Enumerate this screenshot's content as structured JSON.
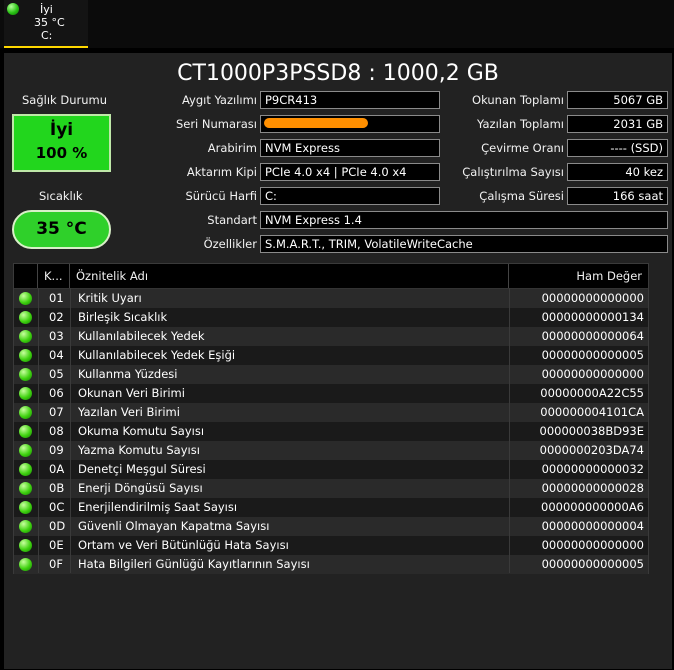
{
  "disk_tab": {
    "status": "İyi",
    "temperature": "35 °C",
    "drive_letter": "C:"
  },
  "title": "CT1000P3PSSD8 : 1000,2 GB",
  "health": {
    "label": "Sağlık Durumu",
    "status": "İyi",
    "percent": "100 %"
  },
  "temperature": {
    "label": "Sıcaklık",
    "value": "35 °C"
  },
  "info": {
    "firmware": {
      "label": "Aygıt Yazılımı",
      "value": "P9CR413"
    },
    "serial": {
      "label": "Seri Numarası",
      "value": ""
    },
    "interface": {
      "label": "Arabirim",
      "value": "NVM Express"
    },
    "transfer_mode": {
      "label": "Aktarım Kipi",
      "value": "PCIe 4.0 x4 | PCIe 4.0 x4"
    },
    "drive_letter": {
      "label": "Sürücü Harfi",
      "value": "C:"
    },
    "standard": {
      "label": "Standart",
      "value": "NVM Express 1.4"
    },
    "features": {
      "label": "Özellikler",
      "value": "S.M.A.R.T., TRIM, VolatileWriteCache"
    }
  },
  "stats": {
    "host_reads": {
      "label": "Okunan Toplamı",
      "value": "5067 GB"
    },
    "host_writes": {
      "label": "Yazılan Toplamı",
      "value": "2031 GB"
    },
    "rotation_rate": {
      "label": "Çevirme Oranı",
      "value": "---- (SSD)"
    },
    "power_on_count": {
      "label": "Çalıştırılma Sayısı",
      "value": "40 kez"
    },
    "power_on_hours": {
      "label": "Çalışma Süresi",
      "value": "166 saat"
    }
  },
  "table": {
    "headers": {
      "id": "K...",
      "name": "Öznitelik Adı",
      "raw": "Ham Değer"
    },
    "rows": [
      {
        "id": "01",
        "name": "Kritik Uyarı",
        "raw": "00000000000000"
      },
      {
        "id": "02",
        "name": "Birleşik Sıcaklık",
        "raw": "00000000000134"
      },
      {
        "id": "03",
        "name": "Kullanılabilecek Yedek",
        "raw": "00000000000064"
      },
      {
        "id": "04",
        "name": "Kullanılabilecek Yedek Eşiği",
        "raw": "00000000000005"
      },
      {
        "id": "05",
        "name": "Kullanma Yüzdesi",
        "raw": "00000000000000"
      },
      {
        "id": "06",
        "name": "Okunan Veri Birimi",
        "raw": "00000000A22C55"
      },
      {
        "id": "07",
        "name": "Yazılan Veri Birimi",
        "raw": "000000004101CA"
      },
      {
        "id": "08",
        "name": "Okuma Komutu Sayısı",
        "raw": "000000038BD93E"
      },
      {
        "id": "09",
        "name": "Yazma Komutu Sayısı",
        "raw": "0000000203DA74"
      },
      {
        "id": "0A",
        "name": "Denetçi Meşgul Süresi",
        "raw": "00000000000032"
      },
      {
        "id": "0B",
        "name": "Enerji Döngüsü Sayısı",
        "raw": "00000000000028"
      },
      {
        "id": "0C",
        "name": "Enerjilendirilmiş Saat Sayısı",
        "raw": "000000000000A6"
      },
      {
        "id": "0D",
        "name": "Güvenli Olmayan Kapatma Sayısı",
        "raw": "00000000000004"
      },
      {
        "id": "0E",
        "name": "Ortam ve Veri Bütünlüğü Hata Sayısı",
        "raw": "00000000000000"
      },
      {
        "id": "0F",
        "name": "Hata Bilgileri Günlüğü Kayıtlarının Sayısı",
        "raw": "00000000000005"
      }
    ]
  }
}
